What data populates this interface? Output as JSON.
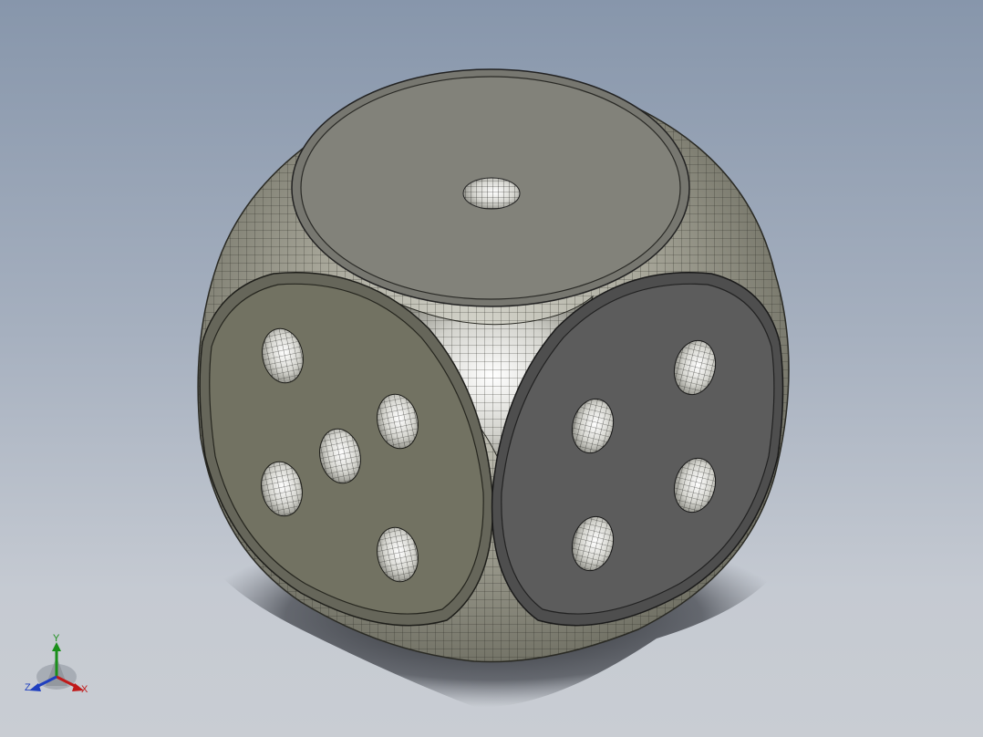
{
  "viewport": {
    "background_top": "#8796ab",
    "background_bottom": "#c9cdd3"
  },
  "model": {
    "name": "die",
    "body_color": "#7f7e70",
    "face_top_color": "#82827a",
    "face_left_color": "#727262",
    "face_right_color": "#5c5c5c",
    "faces": {
      "top_pips": 1,
      "left_pips": 5,
      "right_pips": 4
    }
  },
  "triad": {
    "y_label": "Y",
    "z_label": "Z",
    "x_label": "X",
    "x_color": "#c01a1a",
    "y_color": "#1a8f1a",
    "z_color": "#1f3fbf"
  }
}
